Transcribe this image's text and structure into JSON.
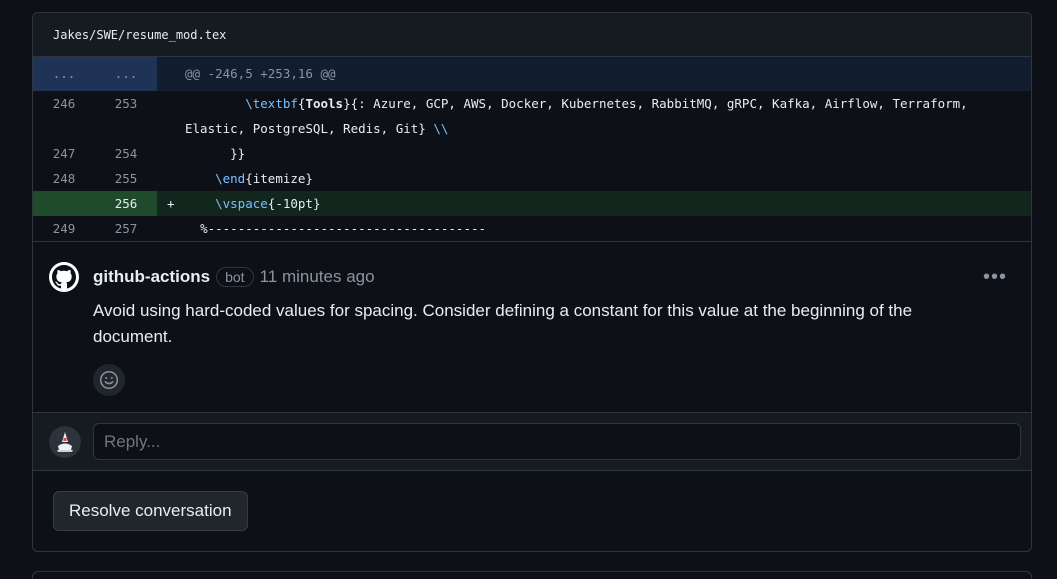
{
  "file": {
    "path": "Jakes/SWE/resume_mod.tex"
  },
  "diff": {
    "hunk": {
      "old": "...",
      "new": "...",
      "header": "@@ -246,5 +253,16 @@"
    },
    "lines": [
      {
        "old": "246",
        "new": "253",
        "marker": "",
        "indent": "        ",
        "cmd": "\\textbf",
        "arg_open": "{",
        "bold": "Tools",
        "rest": "}{: Azure, GCP, AWS, Docker, Kubernetes, RabbitMQ, gRPC, Kafka, Airflow, Terraform,",
        "cont": "Elastic, PostgreSQL, Redis, Git} ",
        "tail": "\\\\"
      },
      {
        "old": "247",
        "new": "254",
        "marker": "",
        "text": "      }}"
      },
      {
        "old": "248",
        "new": "255",
        "marker": "",
        "indent": "    ",
        "cmd": "\\end",
        "rest": "{itemize}"
      },
      {
        "old": "",
        "new": "256",
        "marker": "+",
        "indent": "    ",
        "cmd": "\\vspace",
        "rest": "{-10pt}"
      },
      {
        "old": "249",
        "new": "257",
        "marker": "",
        "text": "  %-------------------------------------"
      }
    ]
  },
  "comment": {
    "author": "github-actions",
    "badge": "bot",
    "time": "11 minutes ago",
    "menu": "•••",
    "body": "Avoid using hard-coded values for spacing. Consider defining a constant for this value at the beginning of the document.",
    "avatar_icon": "github-mark-icon",
    "reaction_icon": "smiley-icon"
  },
  "reply": {
    "placeholder": "Reply..."
  },
  "actions": {
    "resolve_label": "Resolve conversation"
  },
  "colors": {
    "bg": "#0d1117",
    "added_line": "#12261e",
    "hunk": "#121d2f",
    "keyword": "#79c0ff"
  }
}
